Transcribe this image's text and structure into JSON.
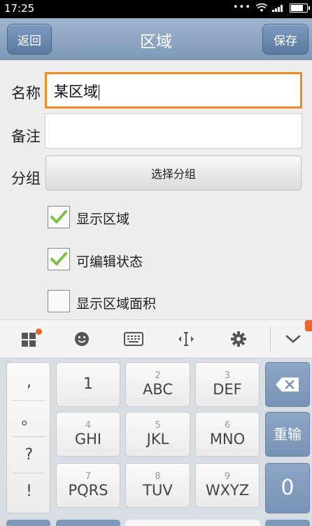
{
  "status": {
    "time": "17:25"
  },
  "header": {
    "back": "返回",
    "title": "区域",
    "save": "保存"
  },
  "form": {
    "name_label": "名称",
    "name_value": "某区域",
    "note_label": "备注",
    "note_value": "",
    "group_label": "分组",
    "group_button": "选择分组",
    "checks": [
      {
        "label": "显示区域",
        "checked": true
      },
      {
        "label": "可编辑状态",
        "checked": true
      },
      {
        "label": "显示区域面积",
        "checked": false
      }
    ]
  },
  "ime_toolbar": {
    "icons": [
      "apps-icon",
      "emoji-icon",
      "keyboard-icon",
      "cursor-icon",
      "settings-icon",
      "collapse-icon"
    ]
  },
  "keyboard": {
    "punct": [
      ",",
      "。",
      "?",
      "!"
    ],
    "keys": [
      {
        "num": "",
        "letters": "1"
      },
      {
        "num": "2",
        "letters": "ABC"
      },
      {
        "num": "3",
        "letters": "DEF"
      },
      {
        "num": "4",
        "letters": "GHI"
      },
      {
        "num": "5",
        "letters": "JKL"
      },
      {
        "num": "6",
        "letters": "MNO"
      },
      {
        "num": "7",
        "letters": "PQRS"
      },
      {
        "num": "8",
        "letters": "TUV"
      },
      {
        "num": "9",
        "letters": "WXYZ"
      }
    ],
    "reinput": "重输",
    "zero": "0"
  },
  "colors": {
    "accent": "#f08c1e",
    "title_bar": "#8aa3c2",
    "check": "#7cc24a"
  }
}
